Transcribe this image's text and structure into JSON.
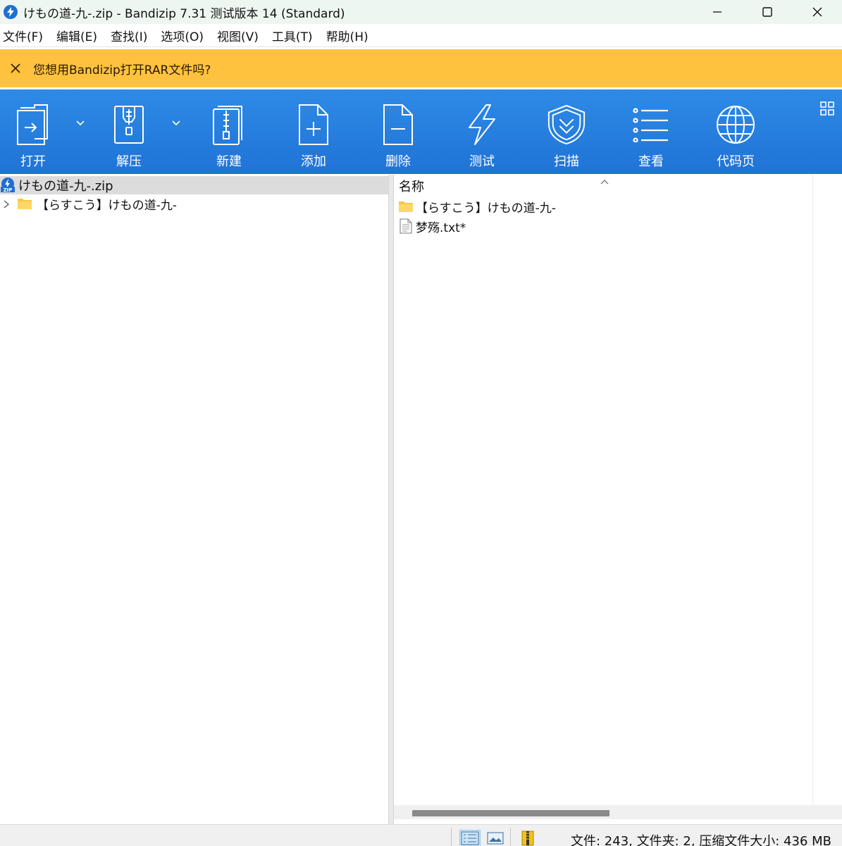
{
  "window": {
    "title": "けもの道-九-.zip - Bandizip 7.31 测试版本 14 (Standard)",
    "controls": [
      "minimize",
      "maximize",
      "close"
    ]
  },
  "menu": [
    {
      "label": "文件(F)"
    },
    {
      "label": "编辑(E)"
    },
    {
      "label": "查找(I)"
    },
    {
      "label": "选项(O)"
    },
    {
      "label": "视图(V)"
    },
    {
      "label": "工具(T)"
    },
    {
      "label": "帮助(H)"
    }
  ],
  "notice": {
    "text": "您想用Bandizip打开RAR文件吗?",
    "background": "#ffc23f"
  },
  "toolbar": {
    "items": [
      {
        "label": "打开",
        "icon": "open-icon",
        "has_dropdown": true
      },
      {
        "label": "解压",
        "icon": "extract-icon",
        "has_dropdown": true
      },
      {
        "label": "新建",
        "icon": "new-archive-icon",
        "has_dropdown": false
      },
      {
        "label": "添加",
        "icon": "add-icon",
        "has_dropdown": false
      },
      {
        "label": "删除",
        "icon": "delete-icon",
        "has_dropdown": false
      },
      {
        "label": "测试",
        "icon": "test-icon",
        "has_dropdown": false
      },
      {
        "label": "扫描",
        "icon": "scan-icon",
        "has_dropdown": false
      },
      {
        "label": "查看",
        "icon": "view-icon",
        "has_dropdown": false
      },
      {
        "label": "代码页",
        "icon": "codepage-icon",
        "has_dropdown": false
      }
    ],
    "accent": "#2a82e0"
  },
  "tree": {
    "root": "けもの道-九-.zip",
    "children": [
      {
        "label": "【らすこう】けもの道-九-",
        "collapsed": true
      }
    ]
  },
  "file_list": {
    "column_header": "名称",
    "sort": "ascending",
    "rows": [
      {
        "name": "【らすこう】けもの道-九-",
        "type": "folder"
      },
      {
        "name": "梦殇.txt*",
        "type": "text-file"
      }
    ]
  },
  "status": {
    "text": "文件: 243, 文件夹: 2, 压缩文件大小: 436 MB"
  }
}
